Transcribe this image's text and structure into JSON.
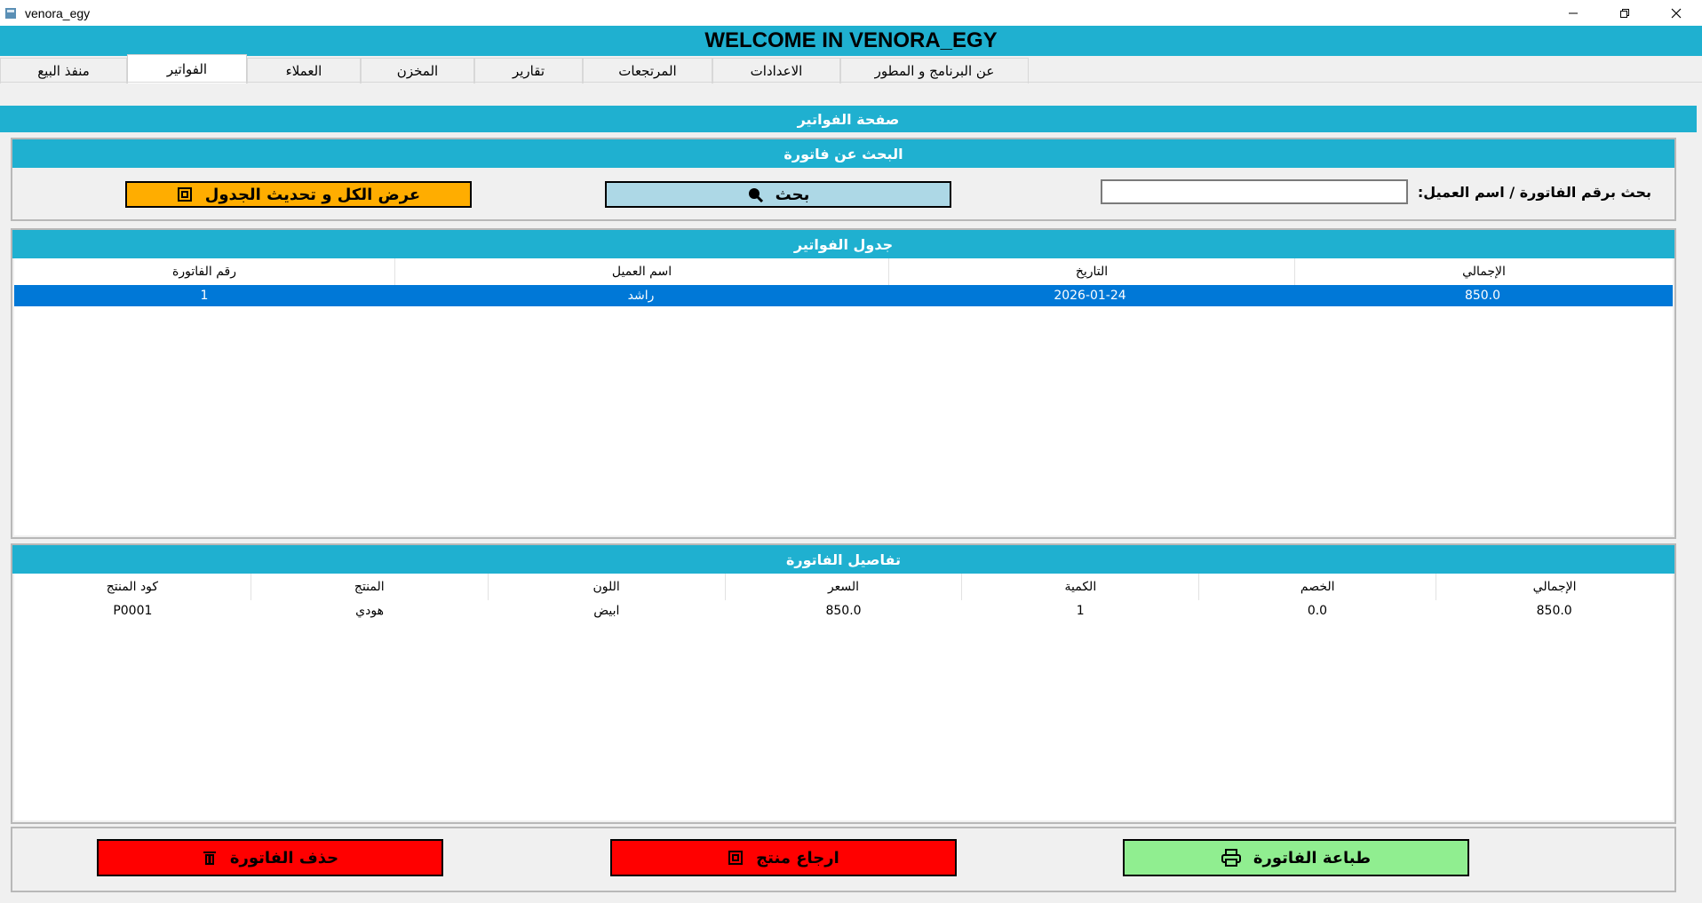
{
  "window": {
    "title": "venora_egy"
  },
  "banner": {
    "title": "WELCOME IN VENORA_EGY"
  },
  "tabs": [
    {
      "label": "منفذ البيع"
    },
    {
      "label": "الفواتير"
    },
    {
      "label": "العملاء"
    },
    {
      "label": "المخزن"
    },
    {
      "label": "تقارير"
    },
    {
      "label": "المرتجعات"
    },
    {
      "label": "الاعدادات"
    },
    {
      "label": "عن البرنامج و المطور"
    }
  ],
  "page": {
    "title": "صفحة الفواتير"
  },
  "search": {
    "title": "البحث عن فاتورة",
    "label": "بحث برقم الفاتورة / اسم العميل:",
    "value": "",
    "search_btn": "بحث",
    "show_all_btn": "عرض الكل و تحديث الجدول"
  },
  "invoices": {
    "title": "جدول الفواتير",
    "columns": [
      "رقم الفاتورة",
      "اسم العميل",
      "التاريخ",
      "الإجمالي"
    ],
    "rows": [
      {
        "number": "1",
        "customer": "راشد",
        "date": "2026-01-24",
        "total": "850.0"
      }
    ]
  },
  "details": {
    "title": "تفاصيل الفاتورة",
    "columns": [
      "كود المنتج",
      "المنتج",
      "اللون",
      "السعر",
      "الكمية",
      "الخصم",
      "الإجمالي"
    ],
    "rows": [
      {
        "code": "P0001",
        "product": "هودي",
        "color": "ابيض",
        "price": "850.0",
        "qty": "1",
        "discount": "0.0",
        "total": "850.0"
      }
    ]
  },
  "actions": {
    "delete": "حذف الفاتورة",
    "return": "ارجاع منتج",
    "print": "طباعة الفاتورة"
  },
  "colors": {
    "accent": "#1fb0d0",
    "selected": "#0078d7",
    "yellow": "#ffad00",
    "red": "#ff0000",
    "green": "#90ee90"
  }
}
